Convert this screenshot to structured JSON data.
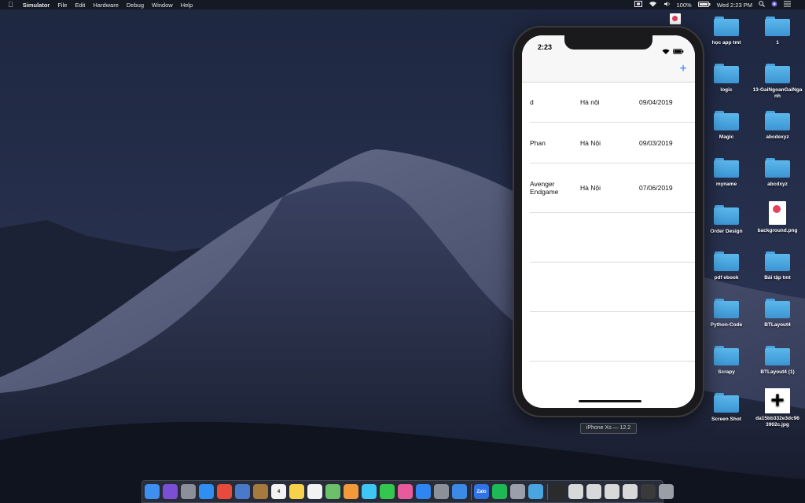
{
  "menubar": {
    "app_name": "Simulator",
    "menus": [
      "File",
      "Edit",
      "Hardware",
      "Debug",
      "Window",
      "Help"
    ],
    "battery": "100%",
    "clock": "Wed 2:23 PM"
  },
  "simulator": {
    "status_time": "2:23",
    "add_button": "+",
    "rows": [
      {
        "name": "d",
        "city": "Hà nội",
        "date": "09/04/2019"
      },
      {
        "name": "Phan",
        "city": "Hà Nội",
        "date": "09/03/2019"
      },
      {
        "name": "Avenger\nEndgame",
        "city": "Hà Nội",
        "date": "07/06/2019"
      }
    ],
    "device_caption": "iPhone Xs — 12.2"
  },
  "desktop": {
    "icons": [
      {
        "label": "học app tmt",
        "type": "folder"
      },
      {
        "label": "1",
        "type": "folder"
      },
      {
        "label": "logic",
        "type": "folder"
      },
      {
        "label": "13-GaiNgoanGaiNganh",
        "type": "folder"
      },
      {
        "label": "Magic",
        "type": "folder"
      },
      {
        "label": "abcdexyz",
        "type": "folder"
      },
      {
        "label": "myname",
        "type": "folder"
      },
      {
        "label": "abcdxyz",
        "type": "folder"
      },
      {
        "label": "Order Design",
        "type": "folder"
      },
      {
        "label": "background.png",
        "type": "image"
      },
      {
        "label": "pdf ebook",
        "type": "folder"
      },
      {
        "label": "Bài tập tmt",
        "type": "folder"
      },
      {
        "label": "Python-Code",
        "type": "folder"
      },
      {
        "label": "BTLayout4",
        "type": "folder"
      },
      {
        "label": "Scrapy",
        "type": "folder"
      },
      {
        "label": "BTLayout4 (1)",
        "type": "folder"
      },
      {
        "label": "Screen Shot",
        "type": "folder"
      },
      {
        "label": "da15bb332e3dc963902c.jpg",
        "type": "plus-image"
      }
    ]
  },
  "dock": {
    "apps": [
      {
        "name": "finder-icon",
        "color": "#3d8ff0",
        "label": ""
      },
      {
        "name": "siri-icon",
        "color": "#7a4fd6",
        "label": ""
      },
      {
        "name": "launchpad-icon",
        "color": "#8a8f99",
        "label": ""
      },
      {
        "name": "safari-icon",
        "color": "#2f8ef2",
        "label": ""
      },
      {
        "name": "chrome-icon",
        "color": "#e84b3c",
        "label": ""
      },
      {
        "name": "preview-icon",
        "color": "#4a79c9",
        "label": ""
      },
      {
        "name": "notes-brown-icon",
        "color": "#a57a3c",
        "label": ""
      },
      {
        "name": "calendar-icon",
        "color": "#f2f2f2",
        "label": "4"
      },
      {
        "name": "notes-icon",
        "color": "#f6d24a",
        "label": ""
      },
      {
        "name": "reminders-icon",
        "color": "#f2f2f2",
        "label": ""
      },
      {
        "name": "maps-icon",
        "color": "#6cc06a",
        "label": ""
      },
      {
        "name": "photos-icon",
        "color": "#f29a3a",
        "label": ""
      },
      {
        "name": "messages-icon",
        "color": "#3ec6f5",
        "label": ""
      },
      {
        "name": "facetime-icon",
        "color": "#33c74f",
        "label": ""
      },
      {
        "name": "itunes-icon",
        "color": "#e85a9c",
        "label": ""
      },
      {
        "name": "app-store-icon",
        "color": "#2f86f0",
        "label": ""
      },
      {
        "name": "system-preferences-icon",
        "color": "#8c9099",
        "label": ""
      },
      {
        "name": "xcode-icon",
        "color": "#3a8ae6",
        "label": ""
      },
      {
        "name": "zalo-icon",
        "color": "#2f73e6",
        "label": "Zalo"
      },
      {
        "name": "spotify-icon",
        "color": "#1db954",
        "label": ""
      },
      {
        "name": "misc-app-icon",
        "color": "#9aa0aa",
        "label": ""
      },
      {
        "name": "folder-app-icon",
        "color": "#4aa4df",
        "label": ""
      },
      {
        "name": "recent-item-1-icon",
        "color": "#2b2b2b",
        "label": ""
      },
      {
        "name": "recent-item-2-icon",
        "color": "#d8d8d8",
        "label": ""
      },
      {
        "name": "recent-item-3-icon",
        "color": "#d8d8d8",
        "label": ""
      },
      {
        "name": "recent-item-4-icon",
        "color": "#d8d8d8",
        "label": ""
      },
      {
        "name": "recent-item-5-icon",
        "color": "#d8d8d8",
        "label": ""
      },
      {
        "name": "downloads-icon",
        "color": "#3a3a3a",
        "label": ""
      },
      {
        "name": "trash-icon",
        "color": "#9a9ea6",
        "label": ""
      }
    ]
  }
}
